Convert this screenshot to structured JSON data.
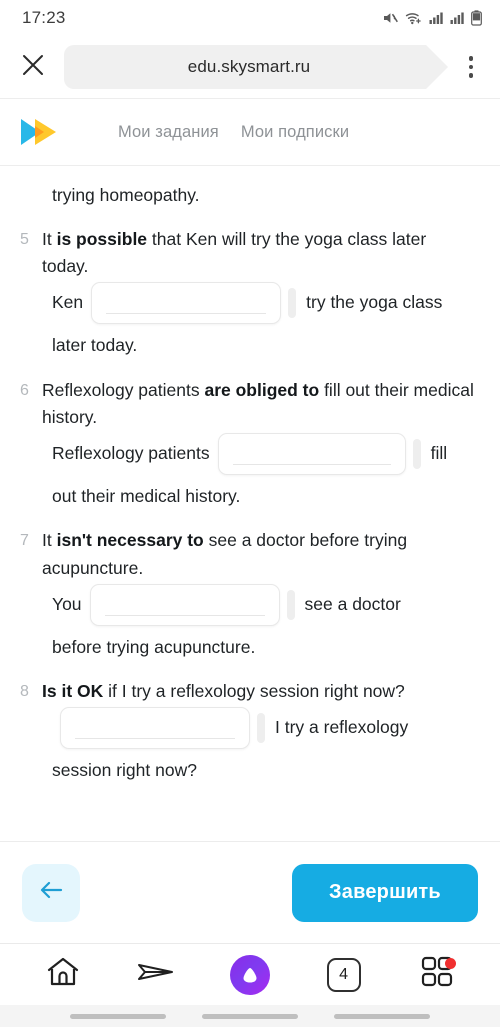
{
  "status_bar": {
    "clock": "17:23",
    "icons": [
      "mute-icon",
      "wifi-icon",
      "signal-1-icon",
      "signal-2-icon",
      "battery-icon"
    ]
  },
  "browser": {
    "close_icon": "close-icon",
    "url": "edu.skysmart.ru",
    "menu_icon": "kebab-menu-icon"
  },
  "site_header": {
    "logo": "skysmart-logo",
    "nav": [
      {
        "label": "Мои задания"
      },
      {
        "label": "Мои подписки"
      }
    ]
  },
  "exercise": {
    "continued_line": "trying homeopathy.",
    "questions": [
      {
        "number": "5",
        "prompt_before": "It ",
        "prompt_bold": "is possible",
        "prompt_after": " that Ken will try the yoga class later today.",
        "answer_pre": "Ken",
        "answer_value": "",
        "answer_post": "try the yoga class",
        "answer_tail": "later today."
      },
      {
        "number": "6",
        "prompt_before": "Reflexology patients ",
        "prompt_bold": "are obliged to",
        "prompt_after": " fill out their medical history.",
        "answer_pre": "Reflexology patients",
        "answer_value": "",
        "answer_post": "fill",
        "answer_tail": "out their medical history."
      },
      {
        "number": "7",
        "prompt_before": "It ",
        "prompt_bold": "isn't necessary to",
        "prompt_after": " see a doctor before trying acupuncture.",
        "answer_pre": "You",
        "answer_value": "",
        "answer_post": "see a doctor",
        "answer_tail": "before trying acupuncture."
      },
      {
        "number": "8",
        "prompt_before": "",
        "prompt_bold": "Is it OK",
        "prompt_after": " if I try a reflexology session right now?",
        "answer_pre": "",
        "answer_value": "",
        "answer_post": "I try a reflexology",
        "answer_tail": "session right now?"
      }
    ]
  },
  "action_bar": {
    "back_icon": "arrow-left-icon",
    "finish_label": "Завершить"
  },
  "bottom_nav": {
    "items": [
      {
        "icon": "home-icon"
      },
      {
        "icon": "paper-plane-icon"
      },
      {
        "icon": "alice-assistant-icon"
      },
      {
        "icon": "tabs-icon",
        "label": "4"
      },
      {
        "icon": "apps-grid-icon",
        "badge": true
      }
    ]
  },
  "colors": {
    "accent_blue": "#16ace3",
    "back_button_bg": "#e4f6fd",
    "badge_red": "#f02f2f",
    "alice_purple": "#8a2be8",
    "logo_cyan": "#29b6e8",
    "logo_yellow": "#ffc82c",
    "number_grey": "#b4b8bc",
    "nav_link_grey": "#8e9296"
  }
}
